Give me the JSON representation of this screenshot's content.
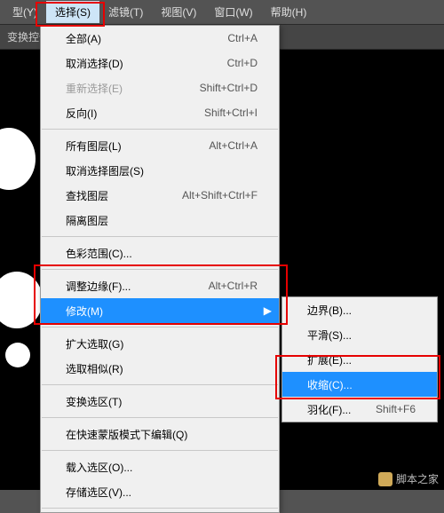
{
  "menubar": {
    "items": [
      {
        "label": "型(Y)"
      },
      {
        "label": "选择(S)"
      },
      {
        "label": "滤镜(T)"
      },
      {
        "label": "视图(V)"
      },
      {
        "label": "窗口(W)"
      },
      {
        "label": "帮助(H)"
      }
    ],
    "open_index": 1
  },
  "toolbar": {
    "label": "变换控件"
  },
  "menu_main": [
    {
      "label": "全部(A)",
      "shortcut": "Ctrl+A"
    },
    {
      "label": "取消选择(D)",
      "shortcut": "Ctrl+D"
    },
    {
      "label": "重新选择(E)",
      "shortcut": "Shift+Ctrl+D",
      "disabled": true
    },
    {
      "label": "反向(I)",
      "shortcut": "Shift+Ctrl+I"
    },
    {
      "sep": true
    },
    {
      "label": "所有图层(L)",
      "shortcut": "Alt+Ctrl+A"
    },
    {
      "label": "取消选择图层(S)"
    },
    {
      "label": "查找图层",
      "shortcut": "Alt+Shift+Ctrl+F"
    },
    {
      "label": "隔离图层"
    },
    {
      "sep": true
    },
    {
      "label": "色彩范围(C)..."
    },
    {
      "sep": true
    },
    {
      "label": "调整边缘(F)...",
      "shortcut": "Alt+Ctrl+R"
    },
    {
      "label": "修改(M)",
      "submenu": true,
      "highlight": true
    },
    {
      "sep": true
    },
    {
      "label": "扩大选取(G)"
    },
    {
      "label": "选取相似(R)"
    },
    {
      "sep": true
    },
    {
      "label": "变换选区(T)"
    },
    {
      "sep": true
    },
    {
      "label": "在快速蒙版模式下编辑(Q)"
    },
    {
      "sep": true
    },
    {
      "label": "载入选区(O)..."
    },
    {
      "label": "存储选区(V)..."
    },
    {
      "sep": true
    }
  ],
  "menu_sub": [
    {
      "label": "边界(B)..."
    },
    {
      "label": "平滑(S)..."
    },
    {
      "label": "扩展(E)..."
    },
    {
      "label": "收缩(C)...",
      "highlight": true
    },
    {
      "label": "羽化(F)...",
      "shortcut": "Shift+F6"
    }
  ],
  "watermark": "脚本之家"
}
